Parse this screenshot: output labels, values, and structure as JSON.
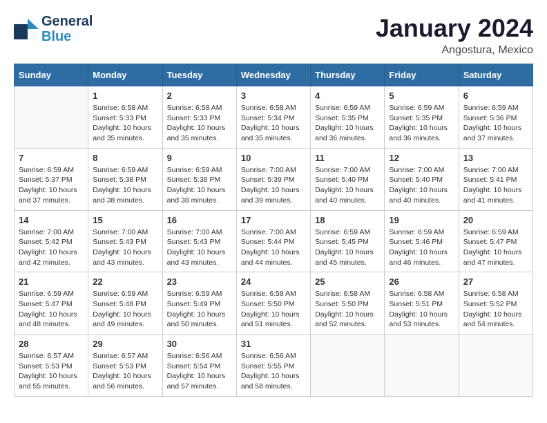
{
  "logo": {
    "general": "General",
    "blue": "Blue"
  },
  "title": "January 2024",
  "location": "Angostura, Mexico",
  "days": [
    "Sunday",
    "Monday",
    "Tuesday",
    "Wednesday",
    "Thursday",
    "Friday",
    "Saturday"
  ],
  "weeks": [
    [
      {
        "day": "",
        "content": ""
      },
      {
        "day": "1",
        "content": "Sunrise: 6:58 AM\nSunset: 5:33 PM\nDaylight: 10 hours\nand 35 minutes."
      },
      {
        "day": "2",
        "content": "Sunrise: 6:58 AM\nSunset: 5:33 PM\nDaylight: 10 hours\nand 35 minutes."
      },
      {
        "day": "3",
        "content": "Sunrise: 6:58 AM\nSunset: 5:34 PM\nDaylight: 10 hours\nand 35 minutes."
      },
      {
        "day": "4",
        "content": "Sunrise: 6:59 AM\nSunset: 5:35 PM\nDaylight: 10 hours\nand 36 minutes."
      },
      {
        "day": "5",
        "content": "Sunrise: 6:59 AM\nSunset: 5:35 PM\nDaylight: 10 hours\nand 36 minutes."
      },
      {
        "day": "6",
        "content": "Sunrise: 6:59 AM\nSunset: 5:36 PM\nDaylight: 10 hours\nand 37 minutes."
      }
    ],
    [
      {
        "day": "7",
        "content": "Sunrise: 6:59 AM\nSunset: 5:37 PM\nDaylight: 10 hours\nand 37 minutes."
      },
      {
        "day": "8",
        "content": "Sunrise: 6:59 AM\nSunset: 5:38 PM\nDaylight: 10 hours\nand 38 minutes."
      },
      {
        "day": "9",
        "content": "Sunrise: 6:59 AM\nSunset: 5:38 PM\nDaylight: 10 hours\nand 38 minutes."
      },
      {
        "day": "10",
        "content": "Sunrise: 7:00 AM\nSunset: 5:39 PM\nDaylight: 10 hours\nand 39 minutes."
      },
      {
        "day": "11",
        "content": "Sunrise: 7:00 AM\nSunset: 5:40 PM\nDaylight: 10 hours\nand 40 minutes."
      },
      {
        "day": "12",
        "content": "Sunrise: 7:00 AM\nSunset: 5:40 PM\nDaylight: 10 hours\nand 40 minutes."
      },
      {
        "day": "13",
        "content": "Sunrise: 7:00 AM\nSunset: 5:41 PM\nDaylight: 10 hours\nand 41 minutes."
      }
    ],
    [
      {
        "day": "14",
        "content": "Sunrise: 7:00 AM\nSunset: 5:42 PM\nDaylight: 10 hours\nand 42 minutes."
      },
      {
        "day": "15",
        "content": "Sunrise: 7:00 AM\nSunset: 5:43 PM\nDaylight: 10 hours\nand 43 minutes."
      },
      {
        "day": "16",
        "content": "Sunrise: 7:00 AM\nSunset: 5:43 PM\nDaylight: 10 hours\nand 43 minutes."
      },
      {
        "day": "17",
        "content": "Sunrise: 7:00 AM\nSunset: 5:44 PM\nDaylight: 10 hours\nand 44 minutes."
      },
      {
        "day": "18",
        "content": "Sunrise: 6:59 AM\nSunset: 5:45 PM\nDaylight: 10 hours\nand 45 minutes."
      },
      {
        "day": "19",
        "content": "Sunrise: 6:59 AM\nSunset: 5:46 PM\nDaylight: 10 hours\nand 46 minutes."
      },
      {
        "day": "20",
        "content": "Sunrise: 6:59 AM\nSunset: 5:47 PM\nDaylight: 10 hours\nand 47 minutes."
      }
    ],
    [
      {
        "day": "21",
        "content": "Sunrise: 6:59 AM\nSunset: 5:47 PM\nDaylight: 10 hours\nand 48 minutes."
      },
      {
        "day": "22",
        "content": "Sunrise: 6:59 AM\nSunset: 5:48 PM\nDaylight: 10 hours\nand 49 minutes."
      },
      {
        "day": "23",
        "content": "Sunrise: 6:59 AM\nSunset: 5:49 PM\nDaylight: 10 hours\nand 50 minutes."
      },
      {
        "day": "24",
        "content": "Sunrise: 6:58 AM\nSunset: 5:50 PM\nDaylight: 10 hours\nand 51 minutes."
      },
      {
        "day": "25",
        "content": "Sunrise: 6:58 AM\nSunset: 5:50 PM\nDaylight: 10 hours\nand 52 minutes."
      },
      {
        "day": "26",
        "content": "Sunrise: 6:58 AM\nSunset: 5:51 PM\nDaylight: 10 hours\nand 53 minutes."
      },
      {
        "day": "27",
        "content": "Sunrise: 6:58 AM\nSunset: 5:52 PM\nDaylight: 10 hours\nand 54 minutes."
      }
    ],
    [
      {
        "day": "28",
        "content": "Sunrise: 6:57 AM\nSunset: 5:53 PM\nDaylight: 10 hours\nand 55 minutes."
      },
      {
        "day": "29",
        "content": "Sunrise: 6:57 AM\nSunset: 5:53 PM\nDaylight: 10 hours\nand 56 minutes."
      },
      {
        "day": "30",
        "content": "Sunrise: 6:56 AM\nSunset: 5:54 PM\nDaylight: 10 hours\nand 57 minutes."
      },
      {
        "day": "31",
        "content": "Sunrise: 6:56 AM\nSunset: 5:55 PM\nDaylight: 10 hours\nand 58 minutes."
      },
      {
        "day": "",
        "content": ""
      },
      {
        "day": "",
        "content": ""
      },
      {
        "day": "",
        "content": ""
      }
    ]
  ]
}
